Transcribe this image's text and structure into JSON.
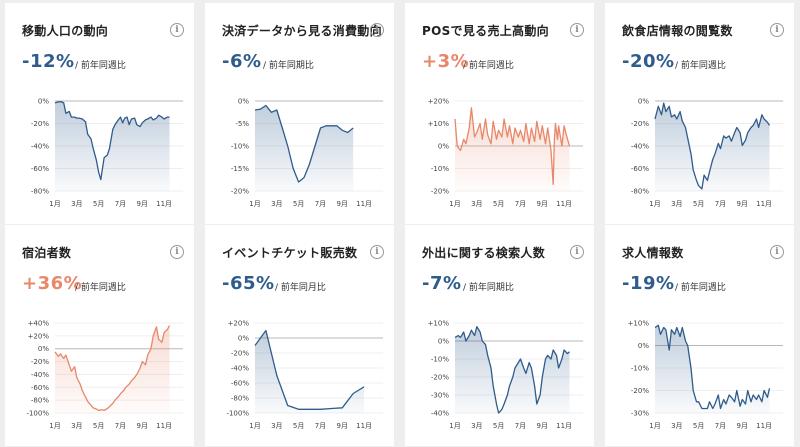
{
  "colors": {
    "blue": "#2f5c8c",
    "orange": "#e8876a",
    "baseline": "#b8b8b8",
    "grid": "#efefef",
    "tick": "#444444"
  },
  "icons": {
    "info": "info-icon"
  },
  "info_glyph": "i",
  "cards": [
    {
      "title": "移動人口の動向",
      "value": "-12%",
      "compare": "/ 前年同週比",
      "color": "blue"
    },
    {
      "title": "決済データから見る消費動向",
      "value": "-6%",
      "compare": "/ 前年同期比",
      "color": "blue"
    },
    {
      "title": "POSで見る売上高動向",
      "value": "+3%",
      "compare": "/ 前年同週比",
      "color": "orange"
    },
    {
      "title": "飲食店情報の閲覧数",
      "value": "-20%",
      "compare": "/ 前年同週比",
      "color": "blue"
    },
    {
      "title": "宿泊者数",
      "value": "+36%",
      "compare": "/ 前年同週比",
      "color": "orange"
    },
    {
      "title": "イベントチケット販売数",
      "value": "-65%",
      "compare": "/ 前年同月比",
      "color": "blue"
    },
    {
      "title": "外出に関する検索人数",
      "value": "-7%",
      "compare": "/ 前年同期比",
      "color": "blue"
    },
    {
      "title": "求人情報数",
      "value": "-19%",
      "compare": "/ 前年同週比",
      "color": "blue"
    }
  ],
  "chart_data": [
    {
      "type": "area",
      "yticks": [
        "0%",
        "-20%",
        "-40%",
        "-60%",
        "-80%"
      ],
      "ylim": [
        -90,
        5
      ],
      "xlim": [
        1,
        12
      ],
      "xticks": [
        "1月",
        "3月",
        "5月",
        "7月",
        "9月",
        "11月"
      ],
      "x": [
        1,
        1.3,
        1.6,
        1.8,
        2.0,
        2.3,
        2.5,
        2.8,
        3.0,
        3.2,
        3.5,
        3.8,
        4.0,
        4.3,
        4.5,
        4.8,
        5.0,
        5.2,
        5.5,
        5.8,
        6.0,
        6.3,
        6.5,
        6.8,
        7.0,
        7.2,
        7.4,
        7.6,
        7.8,
        8.0,
        8.3,
        8.5,
        8.8,
        9.0,
        9.3,
        9.5,
        9.8,
        10.0,
        10.3,
        10.5,
        10.8,
        11.0,
        11.3,
        11.5
      ],
      "y": [
        3,
        4,
        4,
        3,
        -8,
        -6,
        -12,
        -12,
        -13,
        -13,
        -14,
        -17,
        -30,
        -35,
        -45,
        -58,
        -70,
        -78,
        -55,
        -52,
        -45,
        -25,
        -20,
        -15,
        -12,
        -18,
        -13,
        -12,
        -20,
        -14,
        -13,
        -20,
        -22,
        -18,
        -15,
        -14,
        -12,
        -15,
        -13,
        -10,
        -12,
        -14,
        -12,
        -12
      ]
    },
    {
      "type": "area",
      "yticks": [
        "0%",
        "-5%",
        "-10%",
        "-15%",
        "-20%"
      ],
      "ylim": [
        -20,
        0
      ],
      "xlim": [
        1,
        12
      ],
      "xticks": [
        "1月",
        "3月",
        "5月",
        "7月",
        "9月",
        "11月"
      ],
      "x": [
        1,
        1.5,
        2,
        2.5,
        3,
        3.5,
        4,
        4.5,
        5,
        5.5,
        6,
        6.5,
        7,
        7.5,
        8,
        8.5,
        9,
        9.5,
        10
      ],
      "y": [
        -2,
        -1.8,
        -1,
        -2.5,
        -2,
        -6,
        -10,
        -15,
        -18,
        -17,
        -14,
        -10,
        -6,
        -5.5,
        -5.5,
        -5.5,
        -6.5,
        -7,
        -6
      ]
    },
    {
      "type": "area",
      "yticks": [
        "+20%",
        "+10%",
        "0%",
        "-10%",
        "-20%"
      ],
      "ylim": [
        -20,
        20
      ],
      "xlim": [
        1,
        12
      ],
      "xticks": [
        "1月",
        "3月",
        "5月",
        "7月",
        "9月",
        "11月"
      ],
      "x": [
        1,
        1.2,
        1.5,
        1.8,
        2.0,
        2.3,
        2.5,
        2.8,
        3.0,
        3.3,
        3.5,
        3.8,
        4.0,
        4.3,
        4.5,
        4.8,
        5.0,
        5.3,
        5.5,
        5.8,
        6.0,
        6.3,
        6.5,
        6.8,
        7.0,
        7.3,
        7.5,
        7.8,
        8.0,
        8.3,
        8.5,
        8.8,
        9.0,
        9.3,
        9.5,
        9.8,
        10.0,
        10.1,
        10.2,
        10.4,
        10.5,
        10.8,
        11.0,
        11.2,
        11.5
      ],
      "y": [
        12,
        0,
        -2,
        3,
        1,
        8,
        17,
        4,
        6,
        10,
        3,
        12,
        5,
        1,
        11,
        3,
        7,
        4,
        12,
        4,
        9,
        1,
        8,
        4,
        7,
        2,
        10,
        1,
        8,
        2,
        11,
        3,
        9,
        1,
        8,
        -2,
        -17,
        2,
        10,
        3,
        9,
        0,
        9,
        5,
        0
      ]
    },
    {
      "type": "area",
      "yticks": [
        "0%",
        "-20%",
        "-40%",
        "-60%",
        "-80%"
      ],
      "ylim": [
        -80,
        5
      ],
      "xlim": [
        1,
        12
      ],
      "xticks": [
        "1月",
        "3月",
        "5月",
        "7月",
        "9月",
        "11月"
      ],
      "x": [
        1,
        1.3,
        1.6,
        1.8,
        2.0,
        2.3,
        2.5,
        2.8,
        3.0,
        3.3,
        3.5,
        3.8,
        4.0,
        4.3,
        4.5,
        4.8,
        5.0,
        5.3,
        5.5,
        5.8,
        6.0,
        6.3,
        6.5,
        6.8,
        7.0,
        7.3,
        7.5,
        7.8,
        8.0,
        8.3,
        8.5,
        8.8,
        9.0,
        9.3,
        9.5,
        9.8,
        10.0,
        10.3,
        10.5,
        10.8,
        11.0,
        11.3,
        11.5
      ],
      "y": [
        -12,
        0,
        -8,
        3,
        -5,
        0,
        -10,
        -8,
        -12,
        -5,
        -14,
        -20,
        -30,
        -45,
        -60,
        -70,
        -75,
        -78,
        -65,
        -70,
        -62,
        -50,
        -45,
        -35,
        -40,
        -28,
        -30,
        -28,
        -33,
        -25,
        -20,
        -25,
        -37,
        -32,
        -25,
        -20,
        -18,
        -12,
        -20,
        -8,
        -12,
        -15,
        -18
      ]
    },
    {
      "type": "area",
      "yticks": [
        "+40%",
        "+20%",
        "0%",
        "-20%",
        "-40%",
        "-60%",
        "-80%",
        "-100%"
      ],
      "ylim": [
        -100,
        40
      ],
      "xlim": [
        1,
        12
      ],
      "xticks": [
        "1月",
        "3月",
        "5月",
        "7月",
        "9月",
        "11月"
      ],
      "x": [
        1,
        1.3,
        1.5,
        1.8,
        2.0,
        2.3,
        2.5,
        2.8,
        3.0,
        3.3,
        3.5,
        3.8,
        4.0,
        4.3,
        4.5,
        4.8,
        5.0,
        5.3,
        5.5,
        5.8,
        6.0,
        6.3,
        6.5,
        6.8,
        7.0,
        7.3,
        7.5,
        7.8,
        8.0,
        8.3,
        8.5,
        8.8,
        9.0,
        9.3,
        9.5,
        9.8,
        10.0,
        10.3,
        10.5,
        10.8,
        11.0,
        11.3,
        11.5
      ],
      "y": [
        -5,
        -12,
        -8,
        -15,
        -10,
        -25,
        -35,
        -28,
        -45,
        -55,
        -65,
        -75,
        -82,
        -88,
        -92,
        -94,
        -96,
        -95,
        -96,
        -93,
        -90,
        -85,
        -80,
        -75,
        -70,
        -65,
        -60,
        -55,
        -50,
        -45,
        -40,
        -30,
        -20,
        -25,
        -10,
        0,
        20,
        34,
        15,
        10,
        25,
        30,
        36
      ]
    },
    {
      "type": "area",
      "yticks": [
        "+20%",
        "0%",
        "-20%",
        "-40%",
        "-60%",
        "-80%",
        "-100%"
      ],
      "ylim": [
        -100,
        20
      ],
      "xlim": [
        1,
        12
      ],
      "xticks": [
        "1月",
        "3月",
        "5月",
        "7月",
        "9月",
        "11月"
      ],
      "x": [
        1,
        2,
        3,
        4,
        5,
        6,
        7,
        8,
        9,
        10,
        11
      ],
      "y": [
        -10,
        10,
        -50,
        -90,
        -95,
        -95,
        -95,
        -94,
        -93,
        -74,
        -65
      ]
    },
    {
      "type": "area",
      "yticks": [
        "+10%",
        "0%",
        "-10%",
        "-20%",
        "-30%",
        "-40%"
      ],
      "ylim": [
        -40,
        10
      ],
      "xlim": [
        1,
        12
      ],
      "xticks": [
        "1月",
        "3月",
        "5月",
        "7月",
        "9月",
        "11月"
      ],
      "x": [
        1,
        1.3,
        1.5,
        1.8,
        2.0,
        2.3,
        2.5,
        2.8,
        3.0,
        3.3,
        3.5,
        3.8,
        4.0,
        4.3,
        4.5,
        4.8,
        5.0,
        5.3,
        5.5,
        5.8,
        6.0,
        6.3,
        6.5,
        6.8,
        7.0,
        7.3,
        7.5,
        7.8,
        8.0,
        8.3,
        8.5,
        8.8,
        9.0,
        9.3,
        9.5,
        9.8,
        10.0,
        10.3,
        10.5,
        10.8,
        11.0,
        11.3,
        11.5
      ],
      "y": [
        2,
        3,
        2,
        5,
        0,
        3,
        6,
        3,
        8,
        5,
        0,
        -2,
        -8,
        -15,
        -25,
        -35,
        -40,
        -38,
        -35,
        -30,
        -25,
        -20,
        -15,
        -12,
        -10,
        -15,
        -18,
        -12,
        -15,
        -25,
        -35,
        -30,
        -20,
        -10,
        -8,
        -10,
        -5,
        -8,
        -15,
        -10,
        -5,
        -7,
        -6
      ]
    },
    {
      "type": "area",
      "yticks": [
        "+10%",
        "0%",
        "-10%",
        "-20%",
        "-30%"
      ],
      "ylim": [
        -30,
        10
      ],
      "xlim": [
        1,
        12
      ],
      "xticks": [
        "1月",
        "3月",
        "5月",
        "7月",
        "9月",
        "11月"
      ],
      "x": [
        1,
        1.3,
        1.5,
        1.8,
        2.0,
        2.3,
        2.5,
        2.8,
        3.0,
        3.3,
        3.5,
        3.8,
        4.0,
        4.3,
        4.5,
        4.8,
        5.0,
        5.3,
        5.5,
        5.8,
        6.0,
        6.3,
        6.5,
        6.8,
        7.0,
        7.3,
        7.5,
        7.8,
        8.0,
        8.3,
        8.5,
        8.8,
        9.0,
        9.3,
        9.5,
        9.8,
        10.0,
        10.3,
        10.5,
        10.8,
        11.0,
        11.3,
        11.5
      ],
      "y": [
        8,
        9,
        5,
        8,
        7,
        -2,
        7,
        5,
        8,
        4,
        8,
        2,
        0,
        -10,
        -20,
        -25,
        -25,
        -28,
        -28,
        -28,
        -25,
        -28,
        -26,
        -22,
        -28,
        -24,
        -26,
        -22,
        -23,
        -25,
        -20,
        -27,
        -24,
        -26,
        -20,
        -25,
        -22,
        -24,
        -22,
        -25,
        -20,
        -23,
        -19
      ]
    }
  ]
}
